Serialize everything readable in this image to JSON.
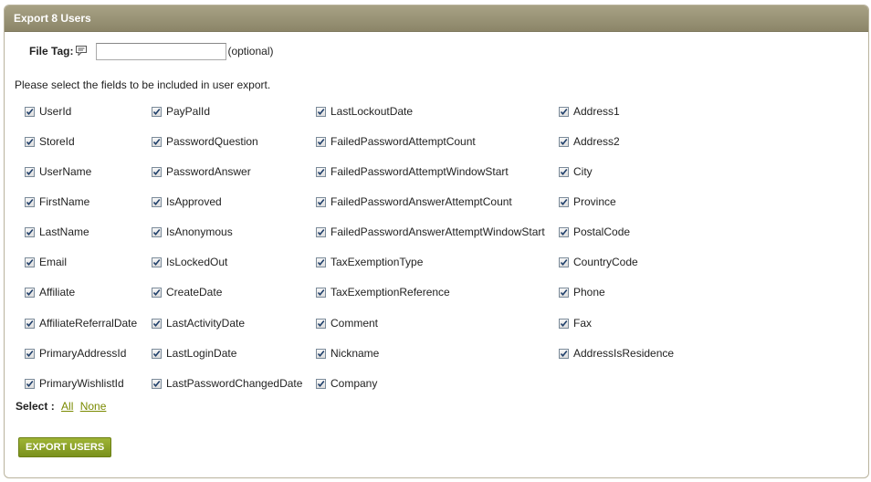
{
  "header": {
    "title": "Export 8 Users"
  },
  "file_tag": {
    "label": "File Tag:",
    "value": "",
    "optional_text": "(optional)"
  },
  "instructions": "Please select the fields to be included in user export.",
  "columns": [
    [
      "UserId",
      "StoreId",
      "UserName",
      "FirstName",
      "LastName",
      "Email",
      "Affiliate",
      "AffiliateReferralDate",
      "PrimaryAddressId",
      "PrimaryWishlistId"
    ],
    [
      "PayPalId",
      "PasswordQuestion",
      "PasswordAnswer",
      "IsApproved",
      "IsAnonymous",
      "IsLockedOut",
      "CreateDate",
      "LastActivityDate",
      "LastLoginDate",
      "LastPasswordChangedDate"
    ],
    [
      "LastLockoutDate",
      "FailedPasswordAttemptCount",
      "FailedPasswordAttemptWindowStart",
      "FailedPasswordAnswerAttemptCount",
      "FailedPasswordAnswerAttemptWindowStart",
      "TaxExemptionType",
      "TaxExemptionReference",
      "Comment",
      "Nickname",
      "Company"
    ],
    [
      "Address1",
      "Address2",
      "City",
      "Province",
      "PostalCode",
      "CountryCode",
      "Phone",
      "Fax",
      "AddressIsResidence"
    ]
  ],
  "select": {
    "label": "Select :",
    "all": "All",
    "none": "None"
  },
  "export_button": "EXPORT USERS",
  "colors": {
    "header": "#978f72",
    "button": "#8aa128",
    "link": "#7a8a00"
  }
}
